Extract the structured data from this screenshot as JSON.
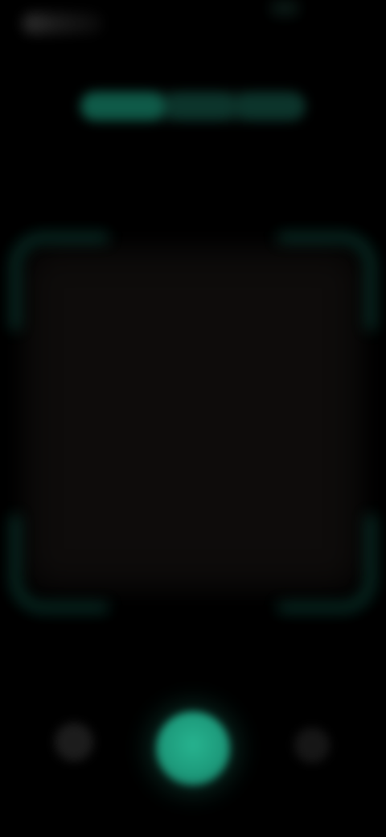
{
  "header": {
    "status_left_icon": "status-indicator-icon",
    "status_right_icon": "battery-icon"
  },
  "mode_tabs": {
    "tabs": [
      {
        "label": "",
        "active": true
      },
      {
        "label": "",
        "active": false
      },
      {
        "label": "",
        "active": false
      }
    ]
  },
  "scan_frame": {
    "corner_color": "#0b3f34"
  },
  "controls": {
    "left_icon": "gallery-icon",
    "shutter_icon": "shutter-icon",
    "right_icon": "flash-icon"
  },
  "colors": {
    "accent": "#1d9a7b",
    "background": "#000000",
    "tab_active": "#0f5a48"
  }
}
